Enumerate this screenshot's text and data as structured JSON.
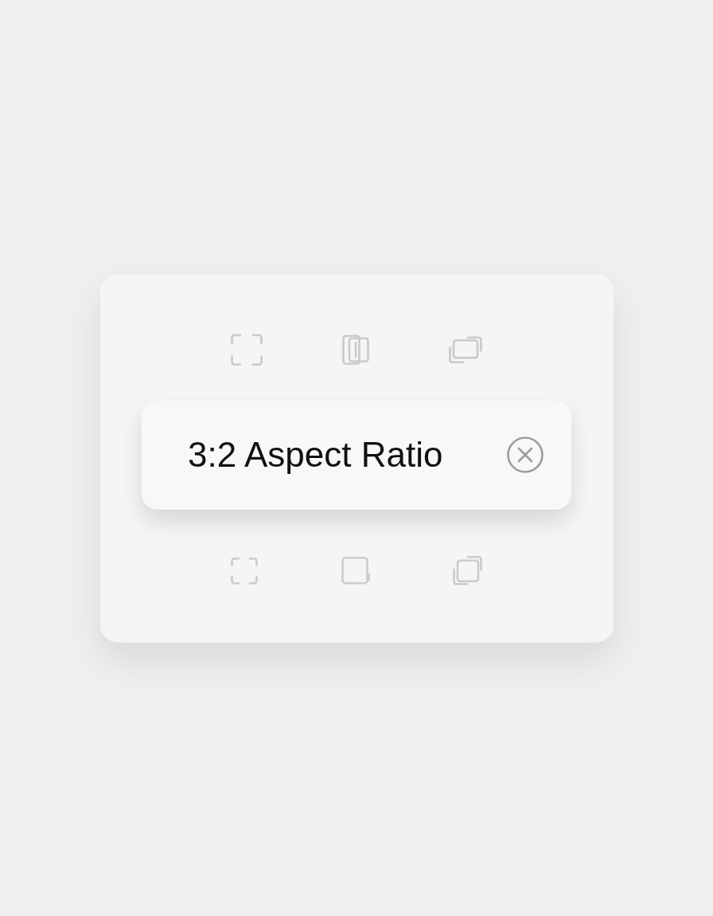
{
  "popup": {
    "label": "3:2 Aspect Ratio"
  }
}
